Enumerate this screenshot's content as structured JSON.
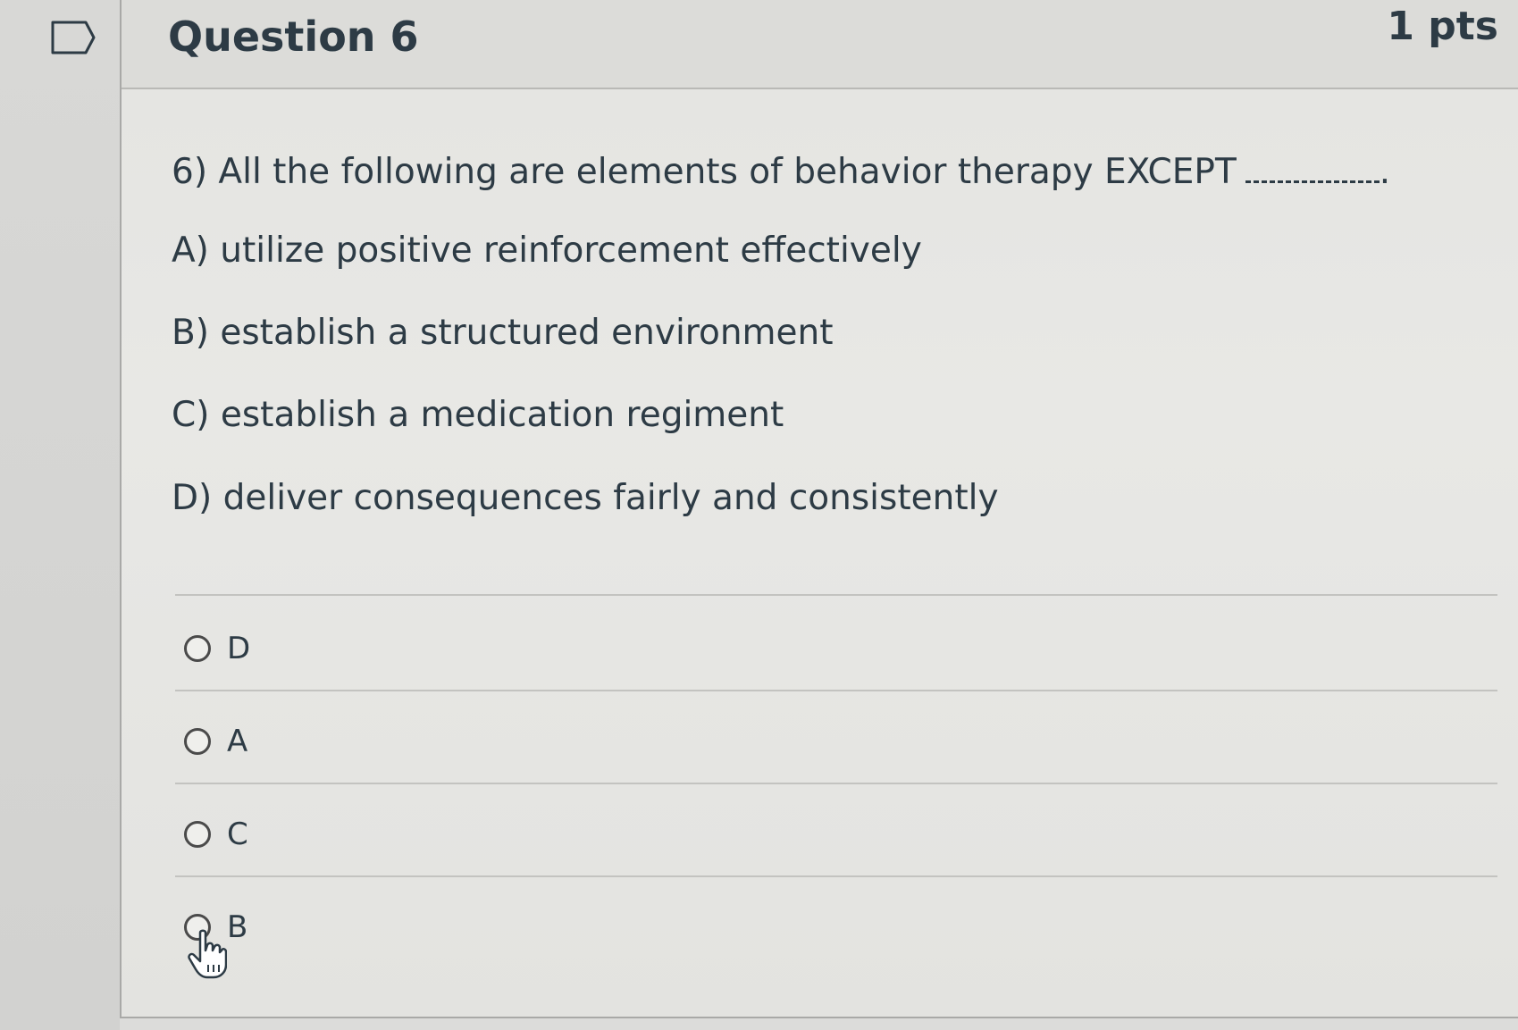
{
  "question": {
    "title": "Question 6",
    "points": "1 pts",
    "prompt": "6) All the following are elements of behavior therapy EXCEPT",
    "prompt_end": ".",
    "options": [
      "A) utilize positive reinforcement effectively",
      "B) establish a structured environment",
      "C) establish a medication regiment",
      "D) deliver consequences fairly and consistently"
    ]
  },
  "answers": [
    {
      "label": "D",
      "selected": false
    },
    {
      "label": "A",
      "selected": false
    },
    {
      "label": "C",
      "selected": false
    },
    {
      "label": "B",
      "selected": false
    }
  ],
  "icons": {
    "flag": "flag-icon",
    "cursor": "hand-pointer-icon"
  }
}
